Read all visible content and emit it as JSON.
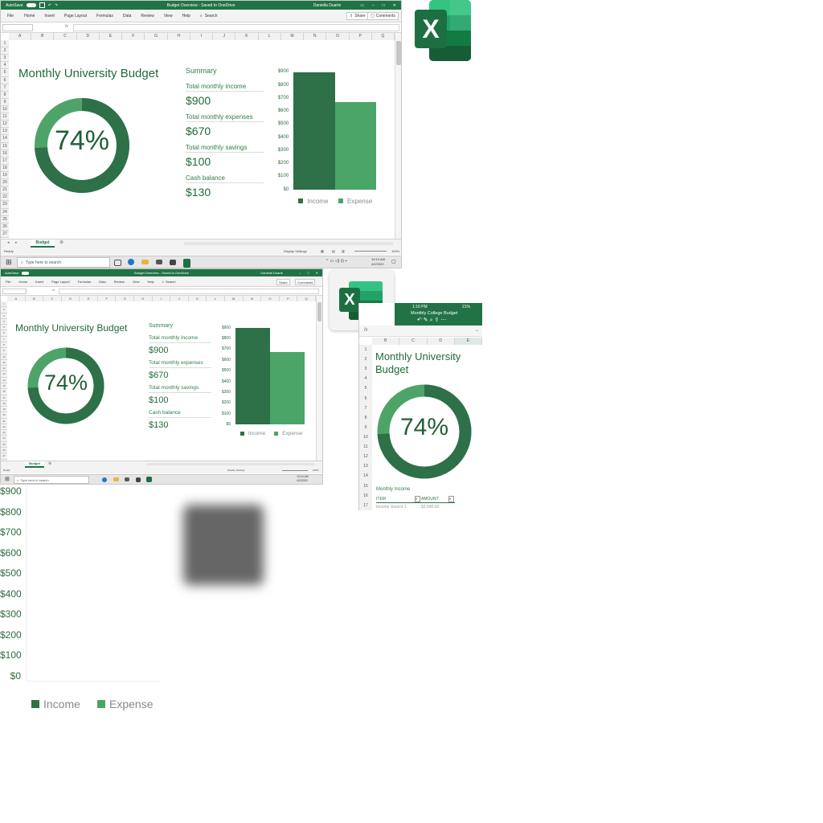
{
  "excel": {
    "autosave_label": "AutoSave",
    "doc_title": "Budget Overview - Saved to OneDrive",
    "user_name": "Daniella Duarte",
    "menu": [
      "File",
      "Home",
      "Insert",
      "Page Layout",
      "Formulas",
      "Data",
      "Review",
      "View",
      "Help"
    ],
    "search_label": "Search",
    "share_label": "Share",
    "comments_label": "Comments",
    "fx_label": "fx",
    "columns": [
      "A",
      "B",
      "C",
      "D",
      "E",
      "F",
      "G",
      "H",
      "I",
      "J",
      "K",
      "L",
      "M",
      "N",
      "O",
      "P",
      "Q"
    ],
    "rows": [
      "1",
      "2",
      "3",
      "4",
      "5",
      "6",
      "7",
      "8",
      "9",
      "10",
      "11",
      "12",
      "13",
      "14",
      "15",
      "16",
      "17",
      "18",
      "19",
      "20",
      "21",
      "22",
      "23",
      "24",
      "25",
      "26",
      "27"
    ],
    "sheet_tab": "Budget",
    "status_ready": "Ready",
    "display_settings": "Display Settings",
    "zoom": "100%"
  },
  "taskbar": {
    "search_placeholder": "Type here to search",
    "time": "10:10 AM",
    "date": "4/2/2020"
  },
  "budget": {
    "title": "Monthly University Budget",
    "summary_label": "Summary",
    "percent_text": "74%",
    "percent_value": 0.74,
    "items": [
      {
        "label": "Total monthly income",
        "value": "$900"
      },
      {
        "label": "Total monthly expenses",
        "value": "$670"
      },
      {
        "label": "Total monthly savings",
        "value": "$100"
      },
      {
        "label": "Cash balance",
        "value": "$130"
      }
    ]
  },
  "chart_data": {
    "type": "bar",
    "categories": [
      "Income",
      "Expense"
    ],
    "values": [
      900,
      670
    ],
    "title": "",
    "xlabel": "",
    "ylabel": "",
    "ylim": [
      0,
      900
    ],
    "yticks": [
      "$900",
      "$800",
      "$700",
      "$600",
      "$500",
      "$400",
      "$300",
      "$200",
      "$100",
      "$0"
    ],
    "legend": [
      "Income",
      "Expense"
    ],
    "colors": [
      "#2e7047",
      "#4ba568"
    ]
  },
  "mobile": {
    "time": "1:16 PM",
    "battery": "21%",
    "doc_title": "Monthly College Budget",
    "fx_label": "fx",
    "columns": [
      "B",
      "C",
      "D",
      "E"
    ],
    "rows": [
      "1",
      "2",
      "3",
      "4",
      "5",
      "6",
      "7",
      "8",
      "9",
      "10",
      "11",
      "12",
      "13",
      "14",
      "15",
      "16",
      "17"
    ],
    "title": "Monthly University Budget",
    "percent_text": "74%",
    "section_label": "Monthly Income",
    "col_item": "ITEM",
    "col_amount": "AMOUNT",
    "row_item": "Income Source 1",
    "row_amount": "$2,500.00"
  },
  "logo": {
    "letter": "X",
    "colors": [
      "#21a366",
      "#107c41",
      "#185c37",
      "#33c481"
    ]
  },
  "zoom_axis": {
    "ticks": [
      "$900",
      "$800",
      "$700",
      "$600",
      "$500",
      "$400",
      "$300",
      "$200",
      "$100",
      "$0"
    ],
    "legend": [
      "Income",
      "Expense"
    ]
  }
}
